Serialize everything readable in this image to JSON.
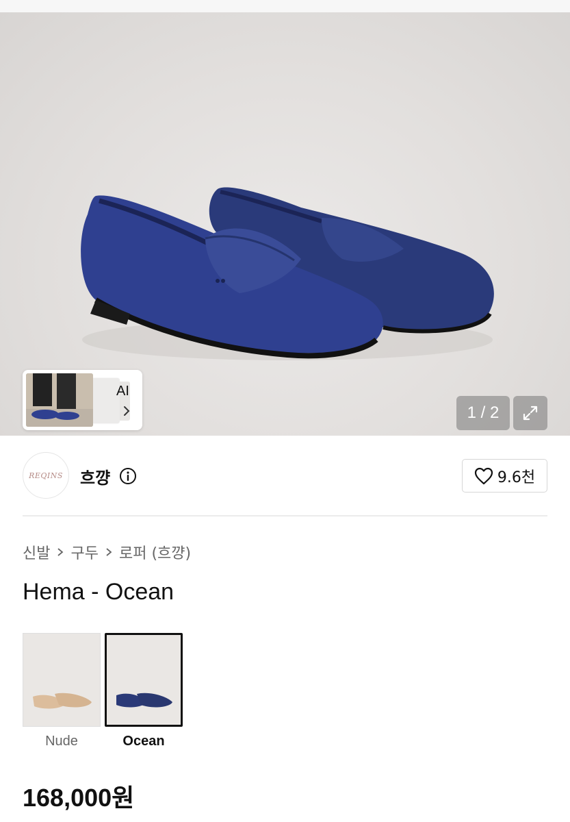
{
  "hero": {
    "image_alt": "Hema Ocean suede loafers",
    "ai_label": "AI",
    "counter": "1 / 2"
  },
  "seller": {
    "avatar_text": "REQINS",
    "name": "흐꺙",
    "likes": "9.6천"
  },
  "breadcrumb": [
    "신발",
    "구두",
    "로퍼 (흐꺙)"
  ],
  "product": {
    "title": "Hema - Ocean",
    "price": "168,000원"
  },
  "variants": [
    {
      "label": "Nude",
      "selected": false,
      "color": "#d9b796"
    },
    {
      "label": "Ocean",
      "selected": true,
      "color": "#2b3a78"
    }
  ],
  "colors": {
    "accent": "#111111",
    "shoe": "#2b3a78"
  }
}
